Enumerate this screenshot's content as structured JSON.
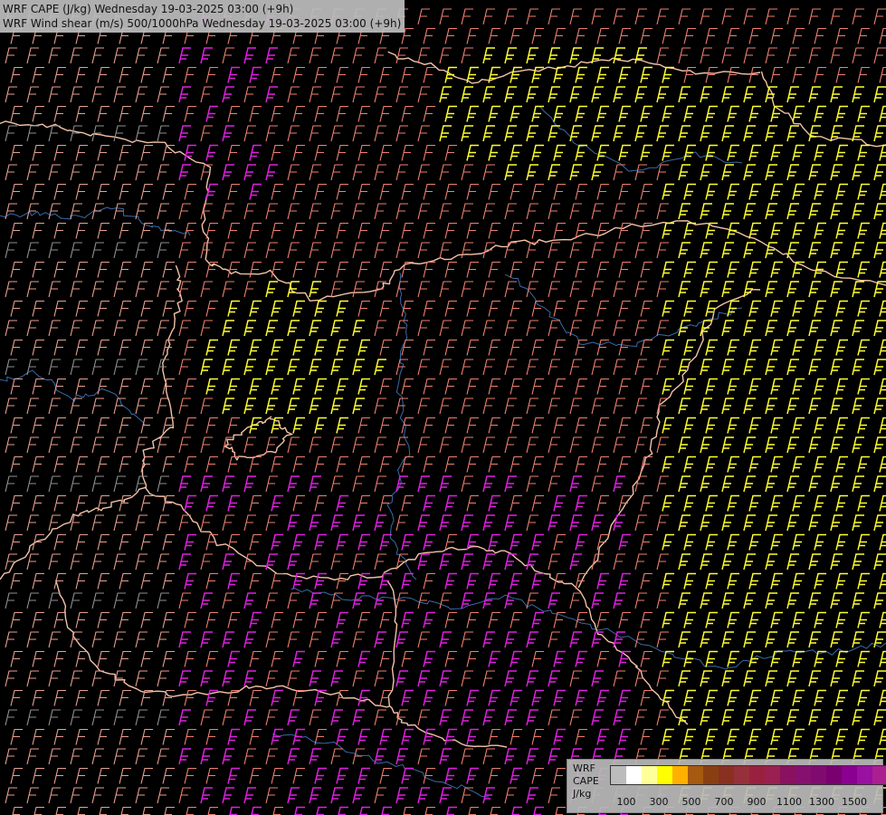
{
  "title": {
    "line1": "WRF CAPE (J/kg) Wednesday 19-03-2025 03:00 (+9h)",
    "line2": "WRF Wind shear (m/s) 500/1000hPa Wednesday 19-03-2025 03:00 (+9h)"
  },
  "legend": {
    "label_lines": [
      "WRF",
      "CAPE",
      "J/kg"
    ],
    "swatches": [
      "#bcbcbc",
      "#ffffff",
      "#ffff9a",
      "#ffff00",
      "#ffb000",
      "#a55a10",
      "#8a3f12",
      "#8a3020",
      "#96303a",
      "#9a2040",
      "#992050",
      "#8a1060",
      "#851070",
      "#800a70",
      "#7a0070",
      "#8a0090",
      "#9a10a0",
      "#aa2090"
    ],
    "tick_labels": [
      "100",
      "300",
      "500",
      "700",
      "900",
      "1100",
      "1300",
      "1500"
    ]
  },
  "barb_colors": {
    "yellow": "#ffff30",
    "salmon": "#f08070",
    "magenta": "#e020e0",
    "light_salmon": "#e8a090",
    "gray": "#909090"
  },
  "map_colors": {
    "borders": "#f2c3a8",
    "rivers": "#3a6aa8"
  }
}
